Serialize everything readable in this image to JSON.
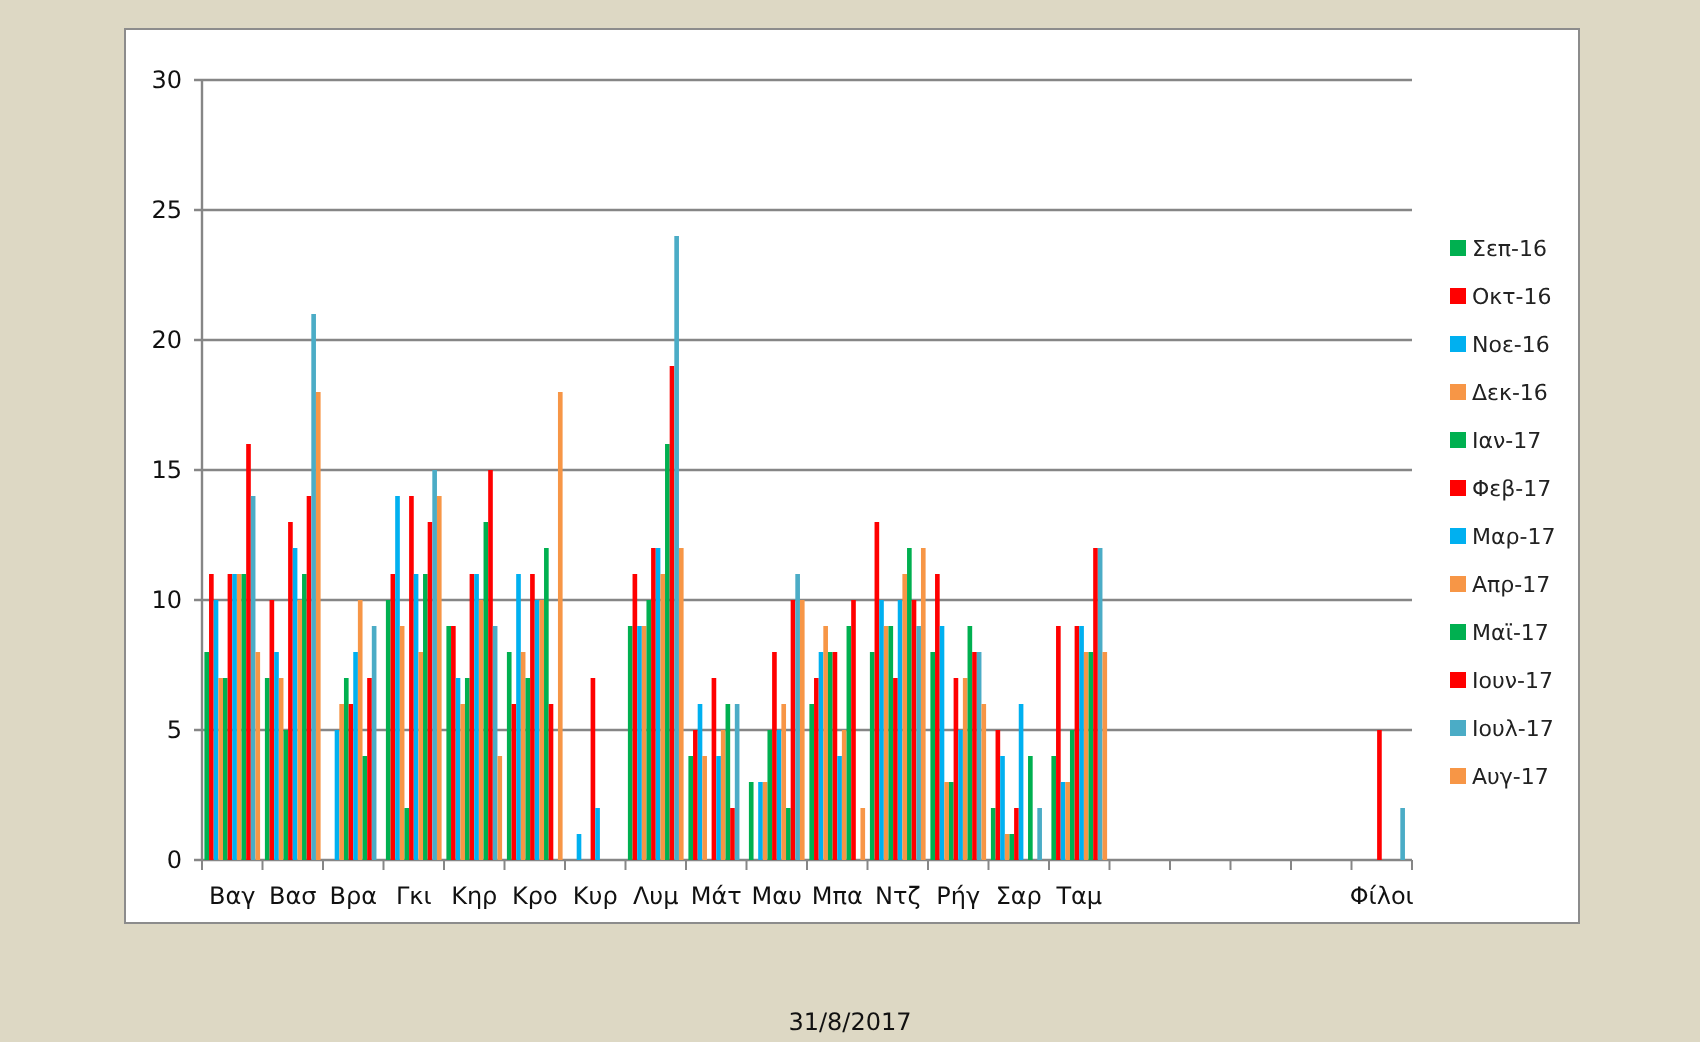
{
  "chart": {
    "chart_data": {
      "type": "bar",
      "grid": true,
      "categories": [
        "Βαγ",
        "Βασ",
        "Βρα",
        "Γκι",
        "Κηρ",
        "Κρο",
        "Κυρ",
        "Λυμ",
        "Μάτ",
        "Μαυ",
        "Μπα",
        "Ντζ",
        "Ρήγ",
        "Σαρ",
        "Ταμ",
        null,
        null,
        null,
        null,
        "Φίλοι"
      ],
      "ylim": [
        0,
        30
      ],
      "yticks": [
        0,
        5,
        10,
        15,
        20,
        25,
        30
      ],
      "series": [
        {
          "name": "Σεπ-16",
          "color": "#00b050",
          "values": [
            8,
            7,
            0,
            10,
            9,
            8,
            0,
            9,
            4,
            3,
            6,
            8,
            8,
            2,
            4,
            null,
            null,
            null,
            null,
            0
          ]
        },
        {
          "name": "Οκτ-16",
          "color": "#ff0000",
          "values": [
            11,
            10,
            0,
            11,
            9,
            6,
            0,
            11,
            5,
            0,
            7,
            13,
            11,
            5,
            9,
            null,
            null,
            null,
            null,
            0
          ]
        },
        {
          "name": "Νοε-16",
          "color": "#00b0f0",
          "values": [
            10,
            8,
            5,
            14,
            7,
            11,
            1,
            9,
            6,
            3,
            8,
            10,
            9,
            4,
            3,
            null,
            null,
            null,
            null,
            0
          ]
        },
        {
          "name": "Δεκ-16",
          "color": "#f79646",
          "values": [
            7,
            7,
            6,
            9,
            6,
            8,
            0,
            9,
            4,
            3,
            9,
            9,
            3,
            1,
            3,
            null,
            null,
            null,
            null,
            0
          ]
        },
        {
          "name": "Ιαν-17",
          "color": "#00b050",
          "values": [
            7,
            5,
            7,
            2,
            7,
            7,
            0,
            10,
            0,
            5,
            8,
            9,
            3,
            1,
            5,
            null,
            null,
            null,
            null,
            0
          ]
        },
        {
          "name": "Φεβ-17",
          "color": "#ff0000",
          "values": [
            11,
            13,
            6,
            14,
            11,
            11,
            7,
            12,
            7,
            8,
            8,
            7,
            7,
            2,
            9,
            null,
            null,
            null,
            null,
            5
          ]
        },
        {
          "name": "Μαρ-17",
          "color": "#00b0f0",
          "values": [
            11,
            12,
            8,
            11,
            11,
            10,
            2,
            12,
            4,
            5,
            4,
            10,
            5,
            6,
            9,
            null,
            null,
            null,
            null,
            0
          ]
        },
        {
          "name": "Απρ-17",
          "color": "#f79646",
          "values": [
            11,
            10,
            10,
            8,
            10,
            10,
            0,
            11,
            5,
            6,
            5,
            11,
            7,
            0,
            8,
            null,
            null,
            null,
            null,
            0
          ]
        },
        {
          "name": "Μαϊ-17",
          "color": "#00b050",
          "values": [
            11,
            11,
            4,
            11,
            13,
            12,
            0,
            16,
            6,
            2,
            9,
            12,
            9,
            4,
            8,
            null,
            null,
            null,
            null,
            0
          ]
        },
        {
          "name": "Ιουν-17",
          "color": "#ff0000",
          "values": [
            16,
            14,
            7,
            13,
            15,
            6,
            0,
            19,
            2,
            10,
            10,
            10,
            8,
            0,
            12,
            null,
            null,
            null,
            null,
            0
          ]
        },
        {
          "name": "Ιουλ-17",
          "color": "#4bacc6",
          "values": [
            14,
            21,
            9,
            15,
            9,
            0,
            0,
            24,
            6,
            11,
            0,
            9,
            8,
            2,
            12,
            null,
            null,
            null,
            null,
            2
          ]
        },
        {
          "name": "Αυγ-17",
          "color": "#f79646",
          "values": [
            8,
            18,
            0,
            14,
            4,
            18,
            0,
            12,
            0,
            10,
            2,
            12,
            6,
            0,
            8,
            null,
            null,
            null,
            null,
            0
          ]
        }
      ]
    }
  },
  "date": "31/8/2017"
}
